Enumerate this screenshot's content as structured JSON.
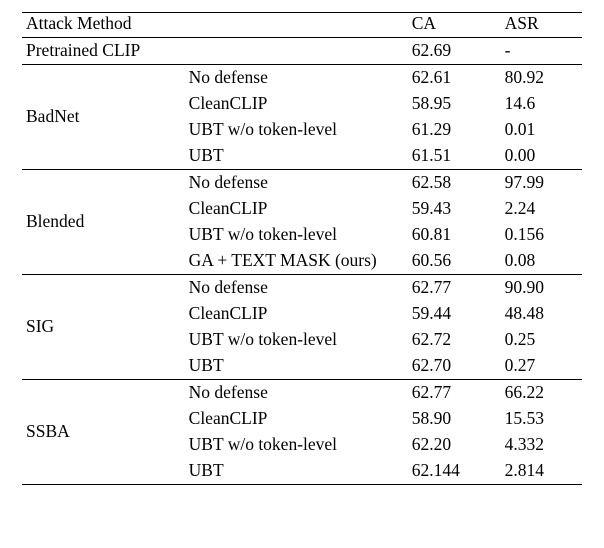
{
  "headers": {
    "attack": "Attack Method",
    "ca": "CA",
    "asr": "ASR"
  },
  "pretrained": {
    "label": "Pretrained CLIP",
    "ca": "62.69",
    "asr": "-"
  },
  "groups": [
    {
      "attack": "BadNet",
      "rows": [
        {
          "defense": "No defense",
          "ca": "62.61",
          "asr": "80.92"
        },
        {
          "defense": "CleanCLIP",
          "ca": "58.95",
          "asr": "14.6"
        },
        {
          "defense": "UBT w/o token-level",
          "ca": "61.29",
          "asr": "0.01"
        },
        {
          "defense": "UBT",
          "ca": "61.51",
          "asr": "0.00"
        }
      ]
    },
    {
      "attack": "Blended",
      "rows": [
        {
          "defense": "No defense",
          "ca": "62.58",
          "asr": "97.99"
        },
        {
          "defense": "CleanCLIP",
          "ca": "59.43",
          "asr": "2.24"
        },
        {
          "defense": "UBT w/o token-level",
          "ca": "60.81",
          "asr": "0.156"
        },
        {
          "defense": "GA + TEXT MASK (ours)",
          "ca": "60.56",
          "asr": "0.08"
        }
      ]
    },
    {
      "attack": "SIG",
      "rows": [
        {
          "defense": "No defense",
          "ca": "62.77",
          "asr": "90.90"
        },
        {
          "defense": "CleanCLIP",
          "ca": "59.44",
          "asr": "48.48"
        },
        {
          "defense": "UBT w/o token-level",
          "ca": "62.72",
          "asr": "0.25"
        },
        {
          "defense": "UBT",
          "ca": "62.70",
          "asr": "0.27"
        }
      ]
    },
    {
      "attack": "SSBA",
      "rows": [
        {
          "defense": "No defense",
          "ca": "62.77",
          "asr": "66.22"
        },
        {
          "defense": "CleanCLIP",
          "ca": "58.90",
          "asr": "15.53"
        },
        {
          "defense": "UBT w/o token-level",
          "ca": "62.20",
          "asr": "4.332"
        },
        {
          "defense": "UBT",
          "ca": "62.144",
          "asr": "2.814"
        }
      ]
    }
  ]
}
